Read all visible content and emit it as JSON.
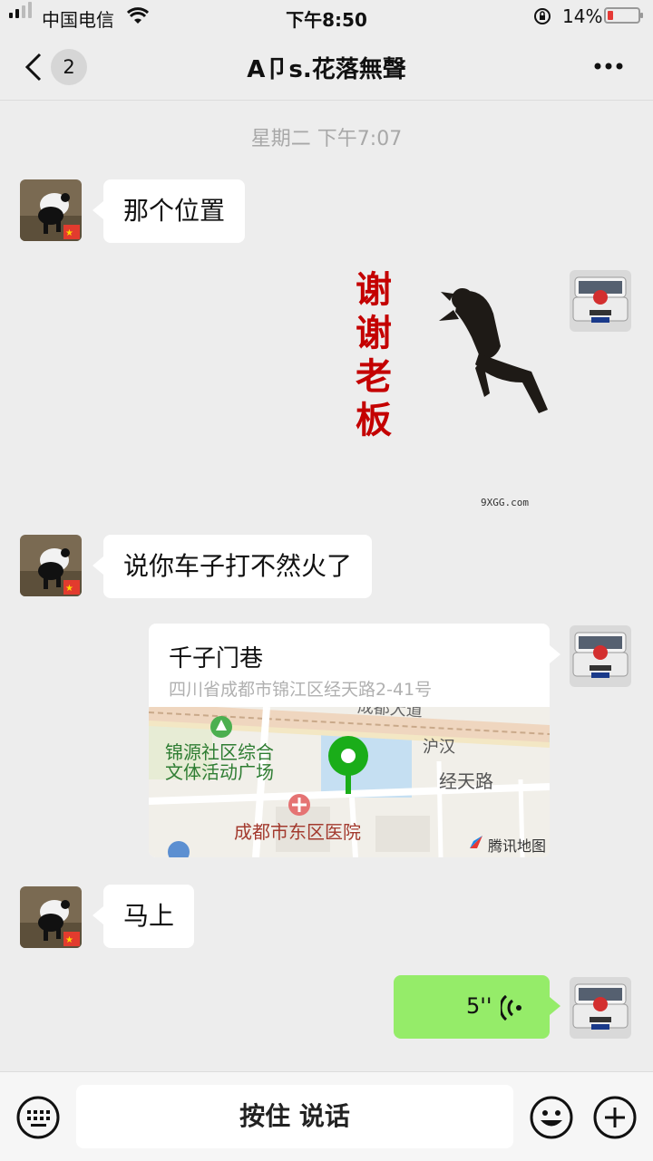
{
  "status_bar": {
    "carrier": "中国电信",
    "time": "下午8:50",
    "battery": "14%"
  },
  "nav": {
    "back_count": "2",
    "title": "A卩s.花落無聲"
  },
  "timestamp": "星期二 下午7:07",
  "messages": [
    {
      "side": "left",
      "type": "text",
      "text": "那个位置"
    },
    {
      "side": "right",
      "type": "sticker",
      "sticker_text": [
        "谢",
        "谢",
        "老",
        "板"
      ],
      "watermark": "9XGG.com"
    },
    {
      "side": "left",
      "type": "text",
      "text": "说你车子打不然火了"
    },
    {
      "side": "right",
      "type": "location",
      "name": "千子门巷",
      "address": "四川省成都市锦江区经天路2-41号",
      "map_labels": {
        "road_top": "成都大道",
        "huhan": "沪汉",
        "jingtian": "经天路",
        "park_line1": "锦源社区综合",
        "park_line2": "文体活动广场",
        "hospital": "成都市东区医院",
        "provider": "腾讯地图"
      }
    },
    {
      "side": "left",
      "type": "text",
      "text": "马上"
    },
    {
      "side": "right",
      "type": "voice",
      "duration": "5''"
    }
  ],
  "input_bar": {
    "hold_to_talk": "按住 说话"
  },
  "colors": {
    "accent_green": "#95ec69",
    "map_pin": "#1aad19",
    "background": "#ededed"
  },
  "icons": [
    "signal-icon",
    "wifi-icon",
    "battery-icon",
    "back-icon",
    "more-icon",
    "voice-wave-icon",
    "keyboard-icon",
    "emoji-icon",
    "plus-icon"
  ]
}
